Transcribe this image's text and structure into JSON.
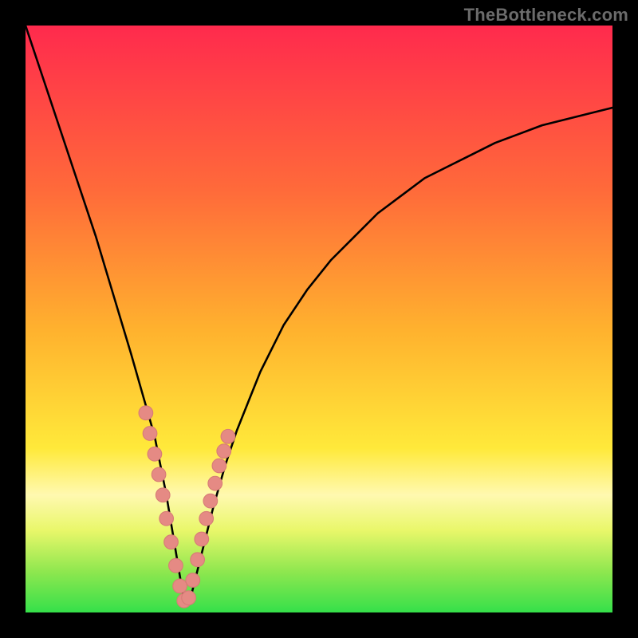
{
  "watermark": "TheBottleneck.com",
  "colors": {
    "frame": "#000000",
    "curve": "#000000",
    "marker_fill": "#e58a84",
    "marker_stroke": "#d77c76",
    "green": "#35e04a",
    "yellow": "#ffe93a",
    "orange": "#ff9a2c",
    "red": "#ff2a4d"
  },
  "chart_data": {
    "type": "line",
    "title": "",
    "xlabel": "",
    "ylabel": "",
    "xlim": [
      0,
      100
    ],
    "ylim": [
      0,
      100
    ],
    "note": "Axes are unlabeled; x/y are percent of plot width/height. Curve is read off gridless image; dip minimum sits ~x=27 near y=0. Background gradient maps y to red→orange→yellow→green (top→bottom), with a lighter-yellow band near y≈20.",
    "series": [
      {
        "name": "curve",
        "x": [
          0,
          3,
          6,
          9,
          12,
          15,
          18,
          20,
          22,
          24,
          25,
          26,
          27,
          28,
          29,
          30,
          32,
          34,
          36,
          38,
          40,
          44,
          48,
          52,
          56,
          60,
          64,
          68,
          72,
          76,
          80,
          84,
          88,
          92,
          96,
          100
        ],
        "y": [
          100,
          91,
          82,
          73,
          64,
          54,
          44,
          37,
          30,
          20,
          14,
          8,
          2,
          2,
          6,
          10,
          18,
          25,
          31,
          36,
          41,
          49,
          55,
          60,
          64,
          68,
          71,
          74,
          76,
          78,
          80,
          81.5,
          83,
          84,
          85,
          86
        ]
      }
    ],
    "markers": {
      "name": "highlight-dots",
      "x": [
        20.5,
        21.2,
        22.0,
        22.7,
        23.4,
        24.0,
        24.8,
        25.6,
        26.3,
        27.0,
        27.8,
        28.5,
        29.3,
        30.0,
        30.8,
        31.5,
        32.3,
        33.0,
        33.8,
        34.5
      ],
      "y": [
        34.0,
        30.5,
        27.0,
        23.5,
        20.0,
        16.0,
        12.0,
        8.0,
        4.5,
        2.0,
        2.5,
        5.5,
        9.0,
        12.5,
        16.0,
        19.0,
        22.0,
        25.0,
        27.5,
        30.0
      ],
      "r": 1.2
    },
    "gradient_stops": [
      {
        "offset": 0.0,
        "color": "#ff2a4d"
      },
      {
        "offset": 0.28,
        "color": "#ff6a3a"
      },
      {
        "offset": 0.52,
        "color": "#ffb22e"
      },
      {
        "offset": 0.72,
        "color": "#ffe93a"
      },
      {
        "offset": 0.8,
        "color": "#fff9b0"
      },
      {
        "offset": 0.86,
        "color": "#e9f76a"
      },
      {
        "offset": 0.93,
        "color": "#8fe74f"
      },
      {
        "offset": 1.0,
        "color": "#35e04a"
      }
    ]
  }
}
